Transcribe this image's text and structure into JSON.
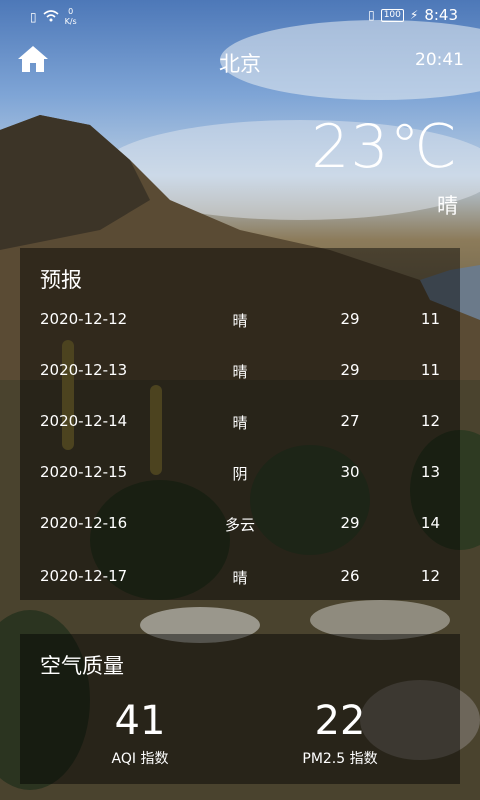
{
  "status": {
    "left_icons": [
      "sim-icon",
      "wifi-icon"
    ],
    "speed_value": "0",
    "speed_unit": "K/s",
    "battery": "100",
    "time": "8:43"
  },
  "header": {
    "city": "北京",
    "update_time": "20:41"
  },
  "now": {
    "temperature": "23℃",
    "condition": "晴"
  },
  "forecast": {
    "title": "预报",
    "items": [
      {
        "date": "2020-12-12",
        "cond": "晴",
        "max": "29",
        "min": "11"
      },
      {
        "date": "2020-12-13",
        "cond": "晴",
        "max": "29",
        "min": "11"
      },
      {
        "date": "2020-12-14",
        "cond": "晴",
        "max": "27",
        "min": "12"
      },
      {
        "date": "2020-12-15",
        "cond": "阴",
        "max": "30",
        "min": "13"
      },
      {
        "date": "2020-12-16",
        "cond": "多云",
        "max": "29",
        "min": "14"
      },
      {
        "date": "2020-12-17",
        "cond": "晴",
        "max": "26",
        "min": "12"
      }
    ]
  },
  "air": {
    "title": "空气质量",
    "aqi_value": "41",
    "aqi_label": "AQI 指数",
    "pm25_value": "22",
    "pm25_label": "PM2.5 指数"
  }
}
